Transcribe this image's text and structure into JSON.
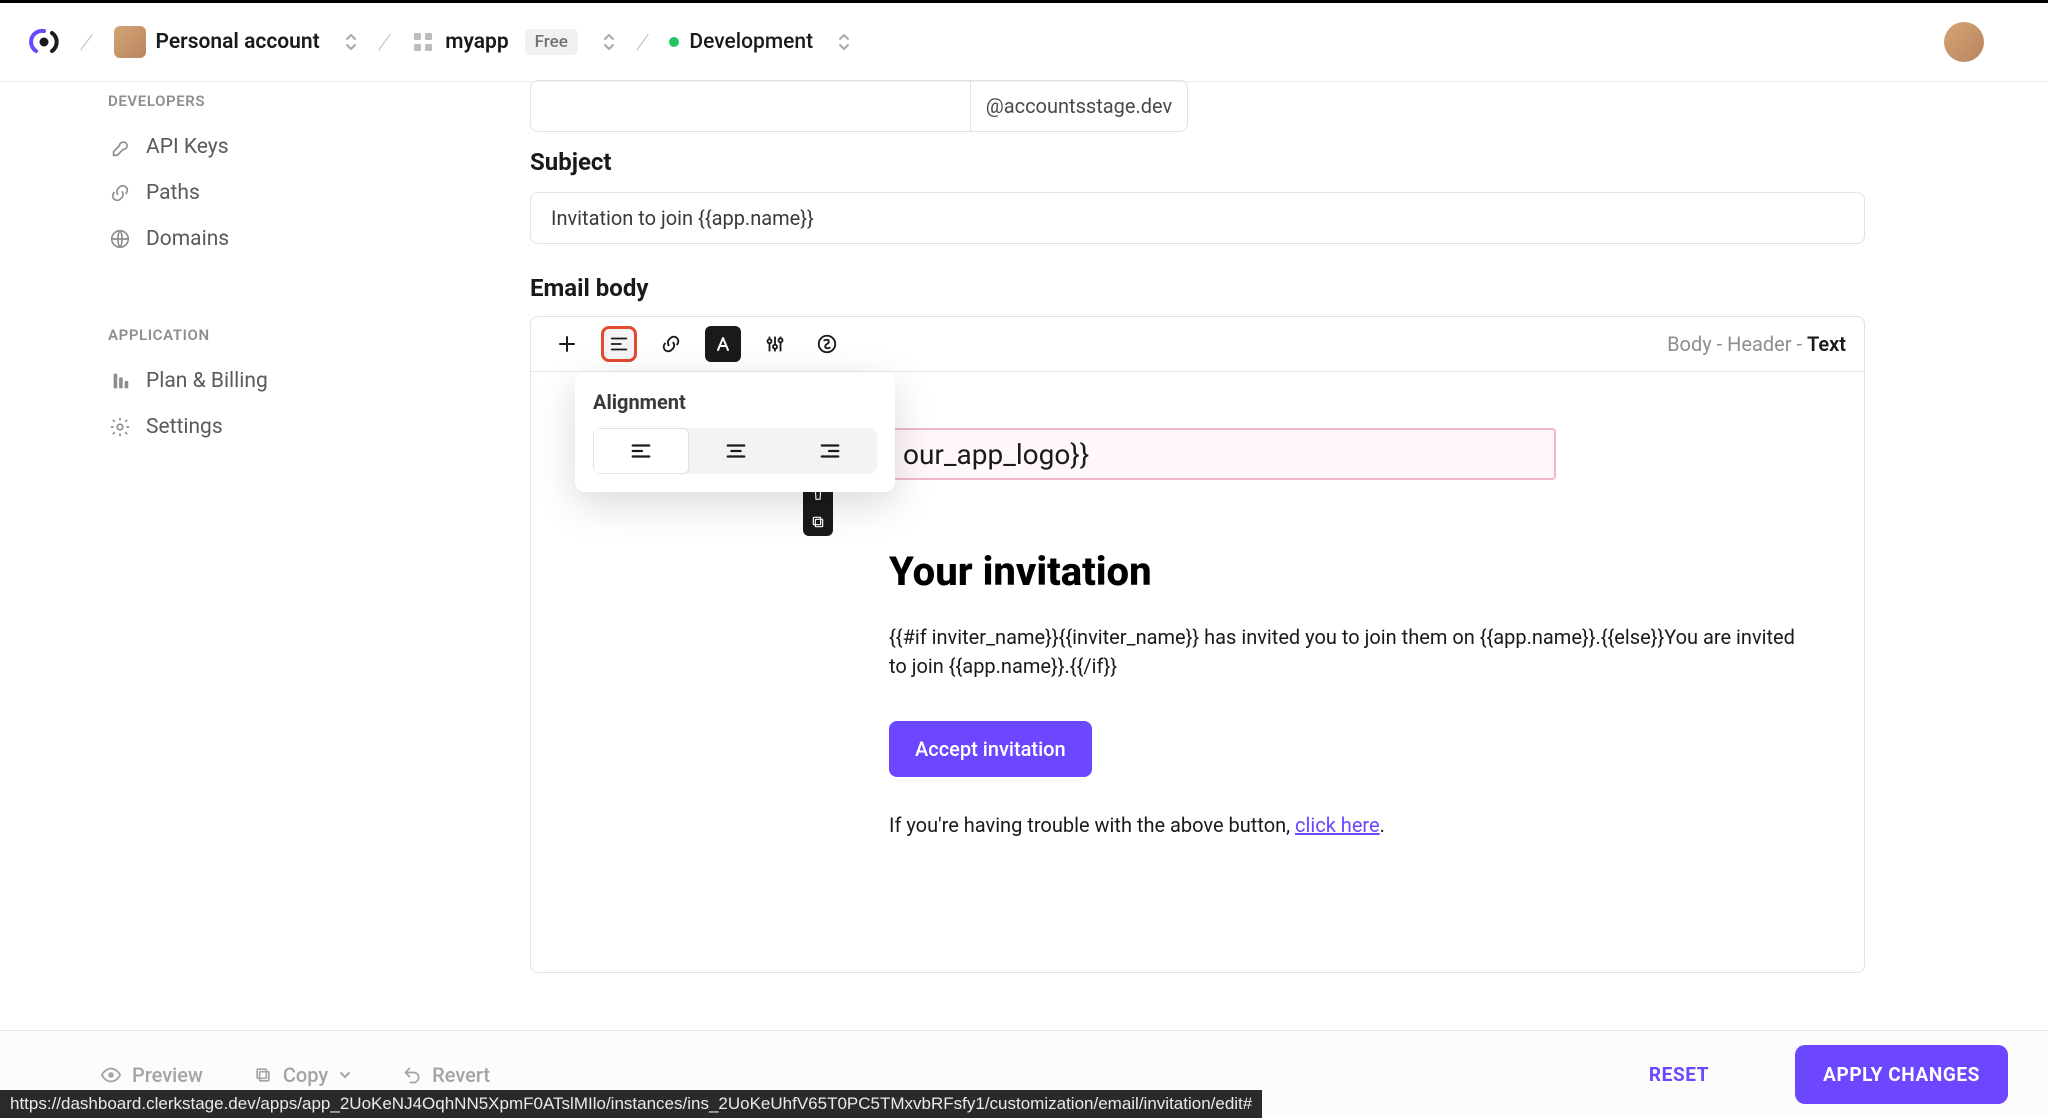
{
  "header": {
    "account_label": "Personal account",
    "app_name": "myapp",
    "plan_badge": "Free",
    "env_name": "Development"
  },
  "sidebar": {
    "developers_label": "DEVELOPERS",
    "items_developers": [
      {
        "label": "API Keys",
        "icon": "key-icon"
      },
      {
        "label": "Paths",
        "icon": "link-icon"
      },
      {
        "label": "Domains",
        "icon": "globe-icon"
      }
    ],
    "application_label": "APPLICATION",
    "items_application": [
      {
        "label": "Plan & Billing",
        "icon": "billing-icon"
      },
      {
        "label": "Settings",
        "icon": "gear-icon"
      }
    ]
  },
  "email": {
    "domain_suffix": "@accountsstage.dev",
    "subject_label": "Subject",
    "subject_value": "Invitation to join {{app.name}}",
    "body_label": "Email body",
    "breadcrumb": {
      "a": "Body",
      "b": "Header",
      "c": "Text",
      "sep": " - "
    },
    "popover_title": "Alignment",
    "logo_placeholder_fragment": "our_app_logo}}",
    "content": {
      "heading": "Your invitation",
      "paragraph": "{{#if inviter_name}}{{inviter_name}} has invited you to join them on {{app.name}}.{{else}}You are invited to join {{app.name}}.{{/if}}",
      "cta_label": "Accept invitation",
      "trouble_prefix": "If you're having trouble with the above button, ",
      "trouble_link": "click here",
      "trouble_suffix": "."
    }
  },
  "footer": {
    "preview_label": "Preview",
    "copy_label": "Copy",
    "revert_label": "Revert",
    "reset_label": "RESET",
    "apply_label": "APPLY CHANGES"
  },
  "status_url": "https://dashboard.clerkstage.dev/apps/app_2UoKeNJ4OqhNN5XpmF0ATslMIlo/instances/ins_2UoKeUhfV65T0PC5TMxvbRFsfy1/customization/email/invitation/edit#"
}
